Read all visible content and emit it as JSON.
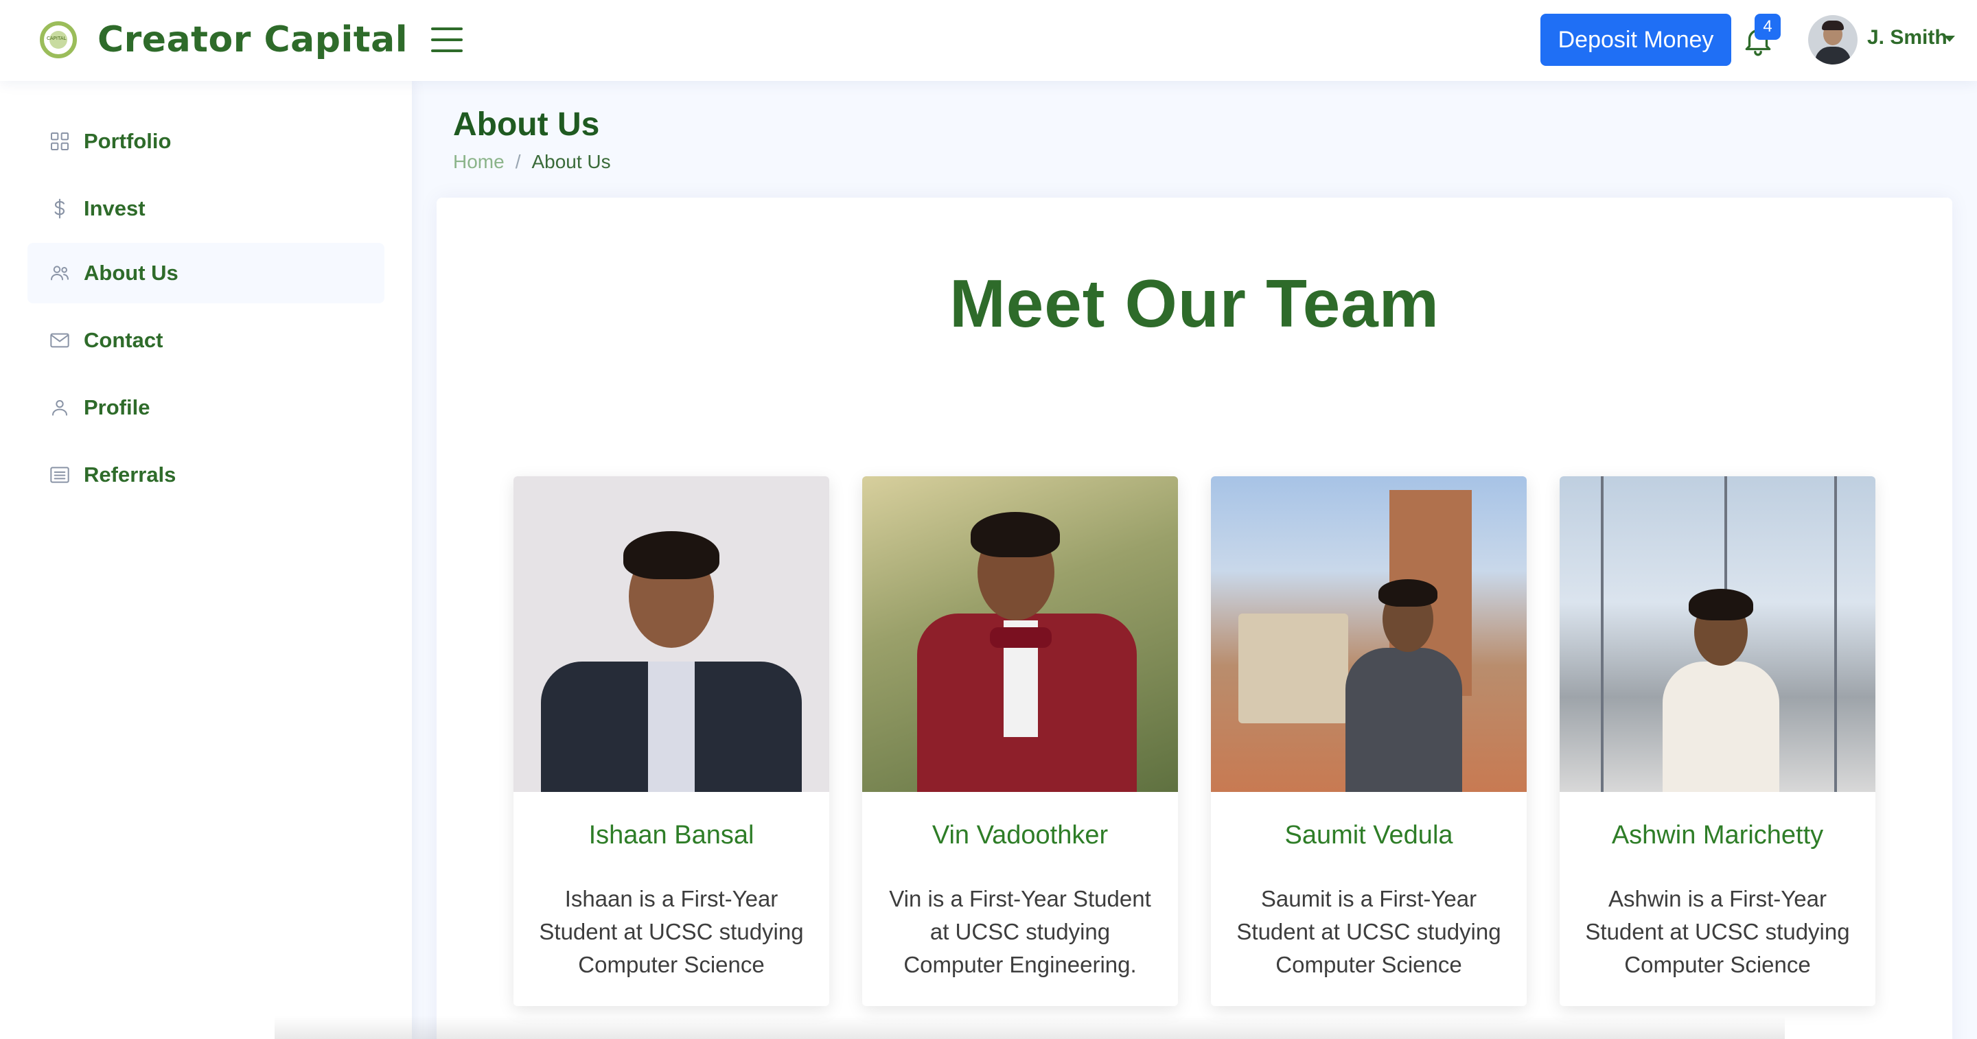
{
  "app": {
    "name": "Creator Capital",
    "logo_text": "CAPITAL"
  },
  "header": {
    "deposit_label": "Deposit Money",
    "notifications_count": "4",
    "user_name": "J. Smith"
  },
  "sidebar": {
    "items": [
      {
        "label": "Portfolio",
        "icon": "grid-icon",
        "active": false
      },
      {
        "label": "Invest",
        "icon": "dollar-icon",
        "active": false
      },
      {
        "label": "About Us",
        "icon": "people-icon",
        "active": true
      },
      {
        "label": "Contact",
        "icon": "envelope-icon",
        "active": false
      },
      {
        "label": "Profile",
        "icon": "person-icon",
        "active": false
      },
      {
        "label": "Referrals",
        "icon": "list-icon",
        "active": false
      }
    ]
  },
  "page": {
    "title": "About Us",
    "breadcrumb": {
      "home": "Home",
      "separator": "/",
      "current": "About Us"
    }
  },
  "team": {
    "heading": "Meet Our Team",
    "members": [
      {
        "name": "Ishaan Bansal",
        "desc": "Ishaan is a First-Year Student at UCSC studying Computer Science"
      },
      {
        "name": "Vin Vadoothker",
        "desc": "Vin is a First-Year Student at UCSC studying Computer Engineering."
      },
      {
        "name": "Saumit Vedula",
        "desc": "Saumit is a First-Year Student at UCSC studying Computer Science"
      },
      {
        "name": "Ashwin Marichetty",
        "desc": "Ashwin is a First-Year Student at UCSC studying Computer Science"
      }
    ]
  },
  "colors": {
    "brand_green": "#2e6b2a",
    "accent_blue": "#1f6ff5",
    "background": "#f6f9ff"
  }
}
